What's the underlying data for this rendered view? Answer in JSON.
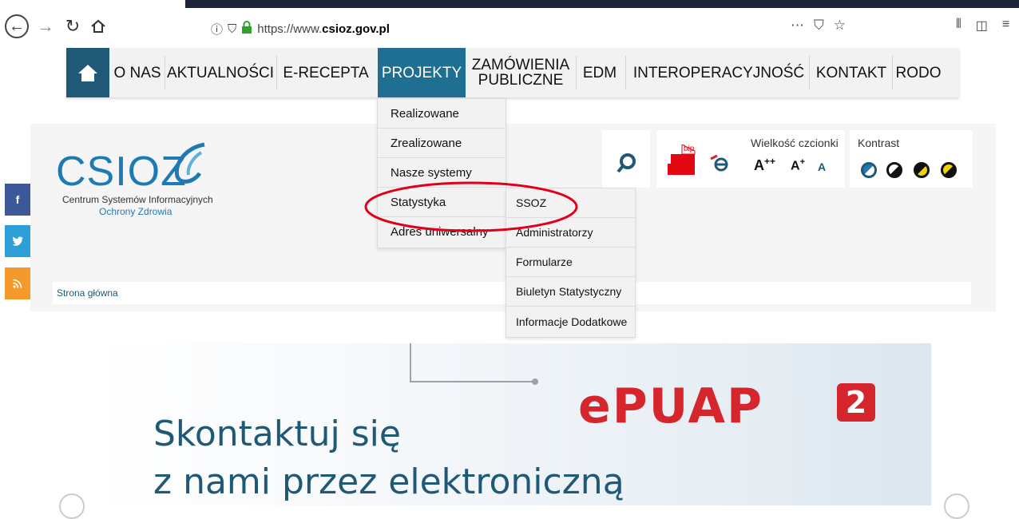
{
  "browser": {
    "url_prefix": "https://www.",
    "url_domain": "csioz.gov.pl",
    "page_actions_icon": "⋯",
    "pocket_icon": "pocket-icon",
    "bookmark_icon": "star-icon"
  },
  "nav": {
    "home_icon": "home-icon",
    "items": [
      "O NAS",
      "AKTUALNOŚCI",
      "E-RECEPTA",
      "PROJEKTY",
      "ZAMÓWIENIA PUBLICZNE",
      "EDM",
      "INTEROPERACYJNOŚĆ",
      "KONTAKT",
      "RODO"
    ],
    "zamowienia_line1": "ZAMÓWIENIA",
    "zamowienia_line2": "PUBLICZNE",
    "active_color": "#1f6f93"
  },
  "dropdown": {
    "items": [
      "Realizowane",
      "Zrealizowane",
      "Nasze systemy",
      "Statystyka",
      "Adres uniwersalny"
    ]
  },
  "submenu": {
    "items": [
      "SSOZ",
      "Administratorzy",
      "Formularze",
      "Biuletyn Statystyczny",
      "Informacje Dodatkowe"
    ]
  },
  "header": {
    "logo_text": "CSIOZ",
    "logo_sub1": "Centrum Systemów Informacyjnych",
    "logo_sub2": "Ochrony Zdrowia",
    "bip_label": "bip",
    "font_size_label": "Wielkość czcionki",
    "font_large": "A",
    "font_large_sup": "++",
    "font_medium": "A",
    "font_medium_sup": "+",
    "font_normal": "A",
    "contrast_label": "Kontrast",
    "breadcrumb": "Strona główna"
  },
  "social": {
    "facebook": "f",
    "twitter": "twitter-icon",
    "rss": "rss-icon"
  },
  "banner": {
    "line1": "Skontaktuj się",
    "line2": "z nami przez elektroniczną",
    "logo": "ePUAP",
    "badge": "2"
  },
  "colors": {
    "brand_blue": "#1d7ab4",
    "dark_blue": "#1f5975",
    "annotation_red": "#e0001a",
    "facebook": "#3b5998",
    "twitter": "#2d9fd8",
    "rss": "#f39a2b"
  }
}
